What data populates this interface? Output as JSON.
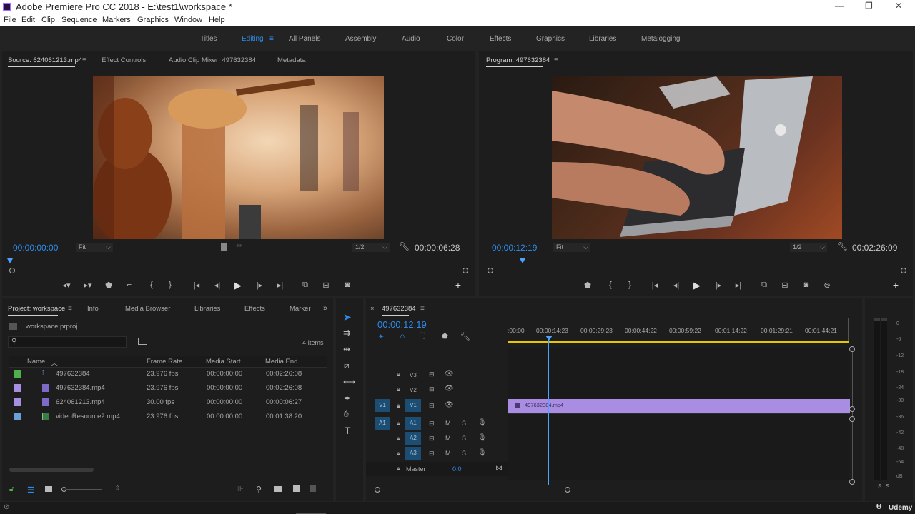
{
  "app": {
    "title": "Adobe Premiere Pro CC 2018 - E:\\test1\\workspace *",
    "window_controls": [
      "—",
      "❐",
      "✕"
    ]
  },
  "menu": [
    "File",
    "Edit",
    "Clip",
    "Sequence",
    "Markers",
    "Graphics",
    "Window",
    "Help"
  ],
  "workspaces": {
    "items": [
      "Titles",
      "Editing",
      "All Panels",
      "Assembly",
      "Audio",
      "Color",
      "Effects",
      "Graphics",
      "Libraries",
      "Metalogging"
    ],
    "active": "Editing",
    "menu_glyph": "≡"
  },
  "source": {
    "tabs": [
      "Source: 624061213.mp4",
      "Effect Controls",
      "Audio Clip Mixer: 497632384",
      "Metadata"
    ],
    "timecode": "00:00:00:00",
    "fit": "Fit",
    "resolution": "1/2",
    "duration": "00:00:06:28"
  },
  "program": {
    "tab": "Program: 497632384",
    "timecode": "00:00:12:19",
    "fit": "Fit",
    "resolution": "1/2",
    "duration": "00:02:26:09"
  },
  "project": {
    "tabs": [
      "Project: workspace",
      "Info",
      "Media Browser",
      "Libraries",
      "Effects",
      "Marker"
    ],
    "file": "workspace.prproj",
    "items_count": "4 Items",
    "columns": [
      "Name",
      "Frame Rate",
      "Media Start",
      "Media End"
    ],
    "rows": [
      {
        "name": "497632384",
        "fps": "23.976 fps",
        "start": "00:00:00:00",
        "end": "00:02:26:08",
        "color": "#4fb14a"
      },
      {
        "name": "497632384.mp4",
        "fps": "23.976 fps",
        "start": "00:00:00:00",
        "end": "00:02:26:08",
        "color": "#a88ee0"
      },
      {
        "name": "624061213.mp4",
        "fps": "30.00 fps",
        "start": "00:00:00:00",
        "end": "00:00:06:27",
        "color": "#a88ee0"
      },
      {
        "name": "videoResource2.mp4",
        "fps": "23.976 fps",
        "start": "00:00:00:00",
        "end": "00:01:38:20",
        "color": "#6aa0d6"
      }
    ]
  },
  "timeline": {
    "tab": "497632384",
    "timecode": "00:00:12:19",
    "ruler": [
      ":00:00",
      "00:00:14:23",
      "00:00:29:23",
      "00:00:44:22",
      "00:00:59:22",
      "00:01:14:22",
      "00:01:29:21",
      "00:01:44:21"
    ],
    "video_tracks": [
      "V3",
      "V2",
      "V1"
    ],
    "audio_tracks": [
      "A1",
      "A2",
      "A3"
    ],
    "src_v": "V1",
    "src_a": "A1",
    "master": "Master",
    "master_value": "0.0",
    "clip": "497632384.mp4",
    "m": "M",
    "s": "S"
  },
  "meter": {
    "scale": [
      "0",
      "-6",
      "-12",
      "-18",
      "-24",
      "-30",
      "-36",
      "-42",
      "-48",
      "-54",
      "dB"
    ],
    "solo": [
      "S",
      "S"
    ]
  },
  "watermark": "Udemy",
  "colors": {
    "accent": "#2d8ceb",
    "clip": "#a98de2",
    "playhead": "#4aa3ff"
  }
}
